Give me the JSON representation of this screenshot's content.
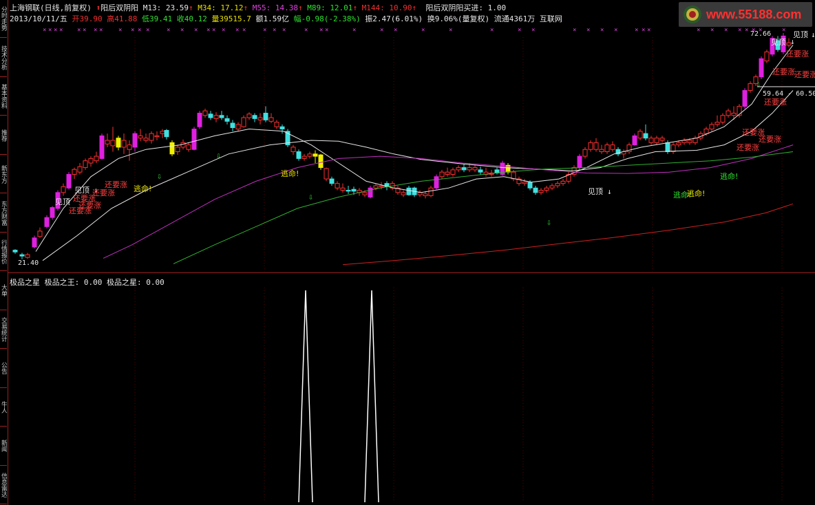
{
  "header": {
    "stock_name": "上海钢联",
    "chart_mode": "(日线,前复权)",
    "indicator_name": "阳后双阴阳",
    "ma": [
      {
        "label": "M13: 23.59",
        "arrow": "↑",
        "color": "#e8e8e8"
      },
      {
        "label": "M34: 17.12",
        "arrow": "↑",
        "color": "#e8e000"
      },
      {
        "label": "M55: 14.38",
        "arrow": "↑",
        "color": "#e040e0"
      },
      {
        "label": "M89: 12.01",
        "arrow": "↑",
        "color": "#30e030"
      },
      {
        "label": "M144: 10.90",
        "arrow": "↑",
        "color": "#f03030"
      }
    ],
    "buy_signal": "阳后双阴阳买进: 1.00",
    "date": "2013/10/11/五",
    "open": "开39.90",
    "high": "高41.88",
    "low": "低39.41",
    "close": "收40.12",
    "volume": "量39515.7",
    "amount": "额1.59亿",
    "change": "幅-0.98(-2.38%)",
    "amplitude": "振2.47(6.01%)",
    "turnover": "换9.06%(量复权)",
    "float_shares": "流通4361万",
    "sector": "互联网"
  },
  "sidebar": {
    "tabs": [
      "分时走势",
      "技术分析",
      "基本资料",
      "推荐",
      "新东方",
      "东方财富",
      "行情报价",
      "大单",
      "交易统计",
      "公告",
      "牛人",
      "新闻",
      "信息雷达"
    ]
  },
  "logo": {
    "text": "www.55188.com"
  },
  "main_chart": {
    "price_labels": {
      "max": "72.66",
      "min": "21.40",
      "box": "59.64 - 60.50"
    },
    "signals": {
      "top": "见顶",
      "rise": "还要涨",
      "escape": "逃命!"
    }
  },
  "sub_chart": {
    "title": "极品之星 极品之王: 0.00 极品之星: 0.00"
  },
  "colors": {
    "up_candle": "#ff3030",
    "down_candle": "#40e0e0",
    "strong_up": "#e020e0",
    "special": "#f0f000",
    "ma13": "#e8e8e8",
    "ma34": "#e8e8e8",
    "ma55": "#c030c0",
    "ma89": "#30b030",
    "ma144": "#d02020",
    "grid": "#600000"
  }
}
